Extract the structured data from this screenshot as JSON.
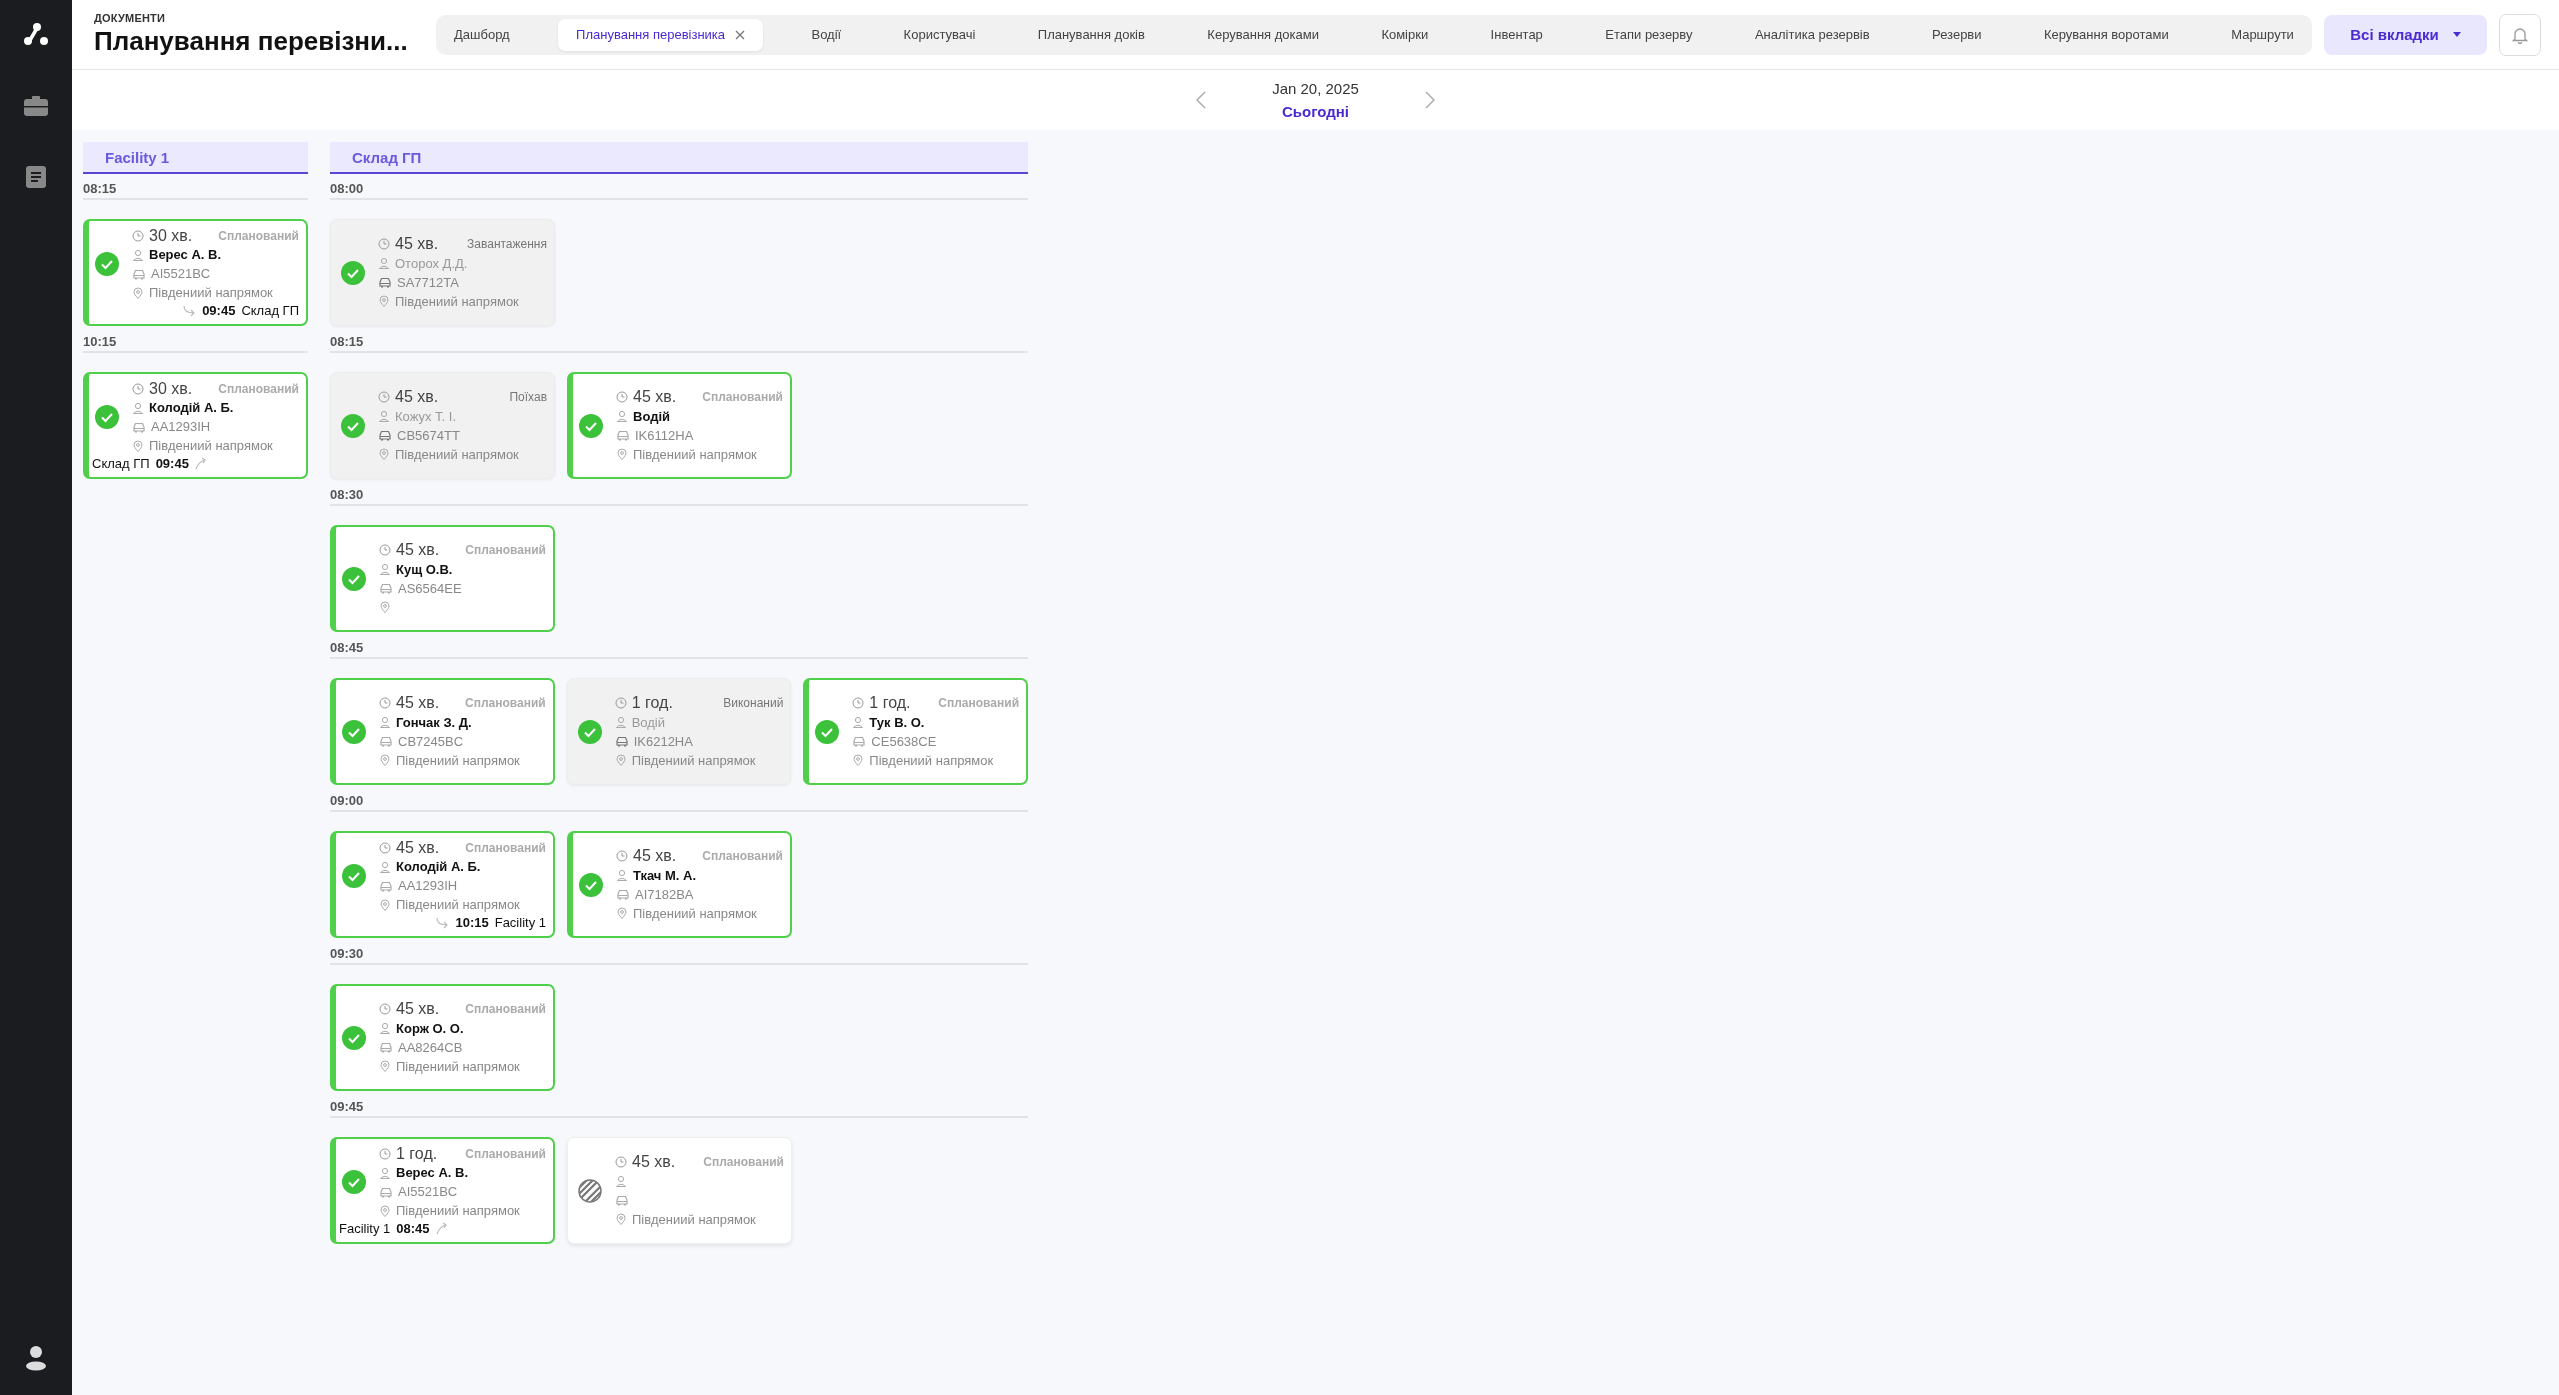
{
  "header": {
    "section": "ДОКУМЕНТИ",
    "title": "Планування перевізни..."
  },
  "tabs": [
    {
      "label": "Дашборд",
      "selected": false,
      "closable": false
    },
    {
      "label": "Планування перевізника",
      "selected": true,
      "closable": true
    },
    {
      "label": "Водії",
      "selected": false,
      "closable": false
    },
    {
      "label": "Користувачі",
      "selected": false,
      "closable": false
    },
    {
      "label": "Планування доків",
      "selected": false,
      "closable": false
    },
    {
      "label": "Керування доками",
      "selected": false,
      "closable": false
    },
    {
      "label": "Комірки",
      "selected": false,
      "closable": false
    },
    {
      "label": "Інвентар",
      "selected": false,
      "closable": false
    },
    {
      "label": "Етапи резерву",
      "selected": false,
      "closable": false
    },
    {
      "label": "Аналітика резервів",
      "selected": false,
      "closable": false
    },
    {
      "label": "Резерви",
      "selected": false,
      "closable": false
    },
    {
      "label": "Керування воротами",
      "selected": false,
      "closable": false
    },
    {
      "label": "Маршрути",
      "selected": false,
      "closable": false
    }
  ],
  "all_tabs_button": {
    "label": "Всі вкладки"
  },
  "date_nav": {
    "date": "Jan 20, 2025",
    "today_link": "Сьогодні"
  },
  "columns": [
    {
      "title": "Facility 1",
      "slots": [
        {
          "time": "08:15",
          "cards": [
            {
              "kind": "outlined",
              "checked": true,
              "duration": "30 хв.",
              "status": "Спланований",
              "driver": "Верес А. В.",
              "plate": "AI5521BC",
              "direction": "Південиий напрямок",
              "transfer": {
                "kind": "outgoing",
                "time": "09:45",
                "place": "Склад ГП"
              }
            }
          ]
        },
        {
          "time": "10:15",
          "cards": [
            {
              "kind": "outlined",
              "checked": true,
              "duration": "30 хв.",
              "status": "Спланований",
              "driver": "Колодій А. Б.",
              "plate": "AA1293IH",
              "direction": "Південиий напрямок",
              "transfer": {
                "kind": "incoming",
                "time": "09:45",
                "place": "Склад ГП"
              }
            }
          ]
        }
      ]
    },
    {
      "title": "Склад ГП",
      "slots": [
        {
          "time": "08:00",
          "cards": [
            {
              "kind": "muted",
              "checked": true,
              "duration": "45 хв.",
              "status": "Завантаження",
              "driver": "Оторох Д.Д.",
              "plate": "SA7712TA",
              "direction": "Південиий напрямок"
            }
          ]
        },
        {
          "time": "08:15",
          "cards": [
            {
              "kind": "muted",
              "checked": true,
              "duration": "45 хв.",
              "status": "Поїхав",
              "driver": "Кожух Т. І.",
              "plate": "CB5674TT",
              "direction": "Південиий напрямок"
            },
            {
              "kind": "outlined",
              "checked": true,
              "duration": "45 хв.",
              "status": "Спланований",
              "driver": "Водій",
              "plate": "IK6112HA",
              "direction": "Південиий напрямок"
            }
          ]
        },
        {
          "time": "08:30",
          "cards": [
            {
              "kind": "outlined",
              "checked": true,
              "duration": "45 хв.",
              "status": "Спланований",
              "driver": "Кущ О.В.",
              "plate": "AS6564EE"
            }
          ]
        },
        {
          "time": "08:45",
          "cards": [
            {
              "kind": "outlined",
              "checked": true,
              "duration": "45 хв.",
              "status": "Спланований",
              "driver": "Гончак З. Д.",
              "plate": "CB7245BC",
              "direction": "Південиий напрямок"
            },
            {
              "kind": "muted",
              "checked": true,
              "duration": "1 год.",
              "status": "Виконаний",
              "driver": "Водій",
              "plate": "IK6212HA",
              "direction": "Південиий напрямок"
            },
            {
              "kind": "outlined",
              "checked": true,
              "duration": "1 год.",
              "status": "Спланований",
              "driver": "Тук В. О.",
              "plate": "CE5638CE",
              "direction": "Південиий напрямок"
            }
          ]
        },
        {
          "time": "09:00",
          "cards": [
            {
              "kind": "outlined",
              "checked": true,
              "duration": "45 хв.",
              "status": "Спланований",
              "driver": "Колодій А. Б.",
              "plate": "AA1293IH",
              "direction": "Південиий напрямок",
              "transfer": {
                "kind": "outgoing",
                "time": "10:15",
                "place": "Facility 1"
              }
            },
            {
              "kind": "outlined",
              "checked": true,
              "duration": "45 хв.",
              "status": "Спланований",
              "driver": "Ткач М. А.",
              "plate": "AI7182BA",
              "direction": "Південиий напрямок"
            }
          ]
        },
        {
          "time": "09:30",
          "cards": [
            {
              "kind": "outlined",
              "checked": true,
              "duration": "45 хв.",
              "status": "Спланований",
              "driver": "Корж О. О.",
              "plate": "AA8264CB",
              "direction": "Південиий напрямок"
            }
          ]
        },
        {
          "time": "09:45",
          "cards": [
            {
              "kind": "outlined",
              "checked": true,
              "duration": "1 год.",
              "status": "Спланований",
              "driver": "Верес А. В.",
              "plate": "AI5521BC",
              "direction": "Південиий напрямок",
              "transfer": {
                "kind": "incoming",
                "time": "08:45",
                "place": "Facility 1"
              }
            },
            {
              "kind": "plain",
              "checked": false,
              "duration": "45 хв.",
              "status": "Спланований",
              "direction": "Південиий напрямок"
            }
          ]
        }
      ]
    }
  ]
}
